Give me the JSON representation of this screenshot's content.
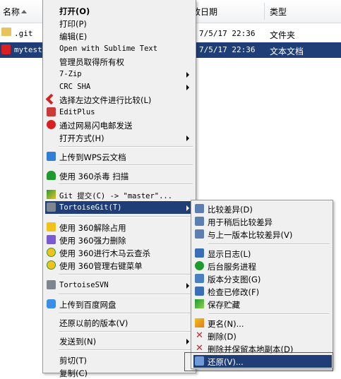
{
  "explorer": {
    "columns": {
      "name": "名称",
      "date": "改日期",
      "type": "类型"
    },
    "files": [
      {
        "name": ".git",
        "date": "7/5/17 22:36",
        "type": "文件夹",
        "selected": false
      },
      {
        "name": "mytest.",
        "date": "7/5/17 22:36",
        "type": "文本文档",
        "selected": true
      }
    ]
  },
  "context_menu": {
    "items": [
      {
        "label": "打开(O)",
        "bold": true
      },
      {
        "label": "打印(P)"
      },
      {
        "label": "编辑(E)"
      },
      {
        "label": "Open with Sublime Text"
      },
      {
        "label": "管理员取得所有权"
      },
      {
        "label": "7-Zip",
        "submenu": true
      },
      {
        "label": "CRC SHA",
        "submenu": true
      },
      {
        "label": "选择左边文件进行比较(L)"
      },
      {
        "label": "EditPlus"
      },
      {
        "label": "通过网易闪电邮发送"
      },
      {
        "label": "打开方式(H)",
        "submenu": true
      },
      {
        "label": "上传到WPS云文档"
      },
      {
        "label": "使用 360杀毒 扫描"
      },
      {
        "label": "Git 提交(C) -> \"master\"..."
      },
      {
        "label": "TortoiseGit(T)",
        "submenu": true
      },
      {
        "label": "使用 360解除占用"
      },
      {
        "label": "使用 360强力删除"
      },
      {
        "label": "使用 360进行木马云查杀"
      },
      {
        "label": "使用 360管理右键菜单"
      },
      {
        "label": "TortoiseSVN",
        "submenu": true
      },
      {
        "label": "上传到百度网盘"
      },
      {
        "label": "还原以前的版本(V)"
      },
      {
        "label": "发送到(N)",
        "submenu": true
      },
      {
        "label": "剪切(T)"
      },
      {
        "label": "复制(C)"
      }
    ]
  },
  "submenu": {
    "items": [
      {
        "label": "比较差异(D)"
      },
      {
        "label": "用于稍后比较差异"
      },
      {
        "label": "与上一版本比较差异(V)"
      },
      {
        "label": "显示日志(L)"
      },
      {
        "label": "后台服务进程"
      },
      {
        "label": "版本分支图(G)"
      },
      {
        "label": "检查已修改(F)"
      },
      {
        "label": "保存贮藏"
      },
      {
        "label": "更名(N)..."
      },
      {
        "label": "删除(D)"
      },
      {
        "label": "删除并保留本地副本(D)"
      },
      {
        "label": "还原(V)..."
      }
    ]
  },
  "colors": {
    "selection": "#1f3e78",
    "highlight_box": "#e02020"
  }
}
